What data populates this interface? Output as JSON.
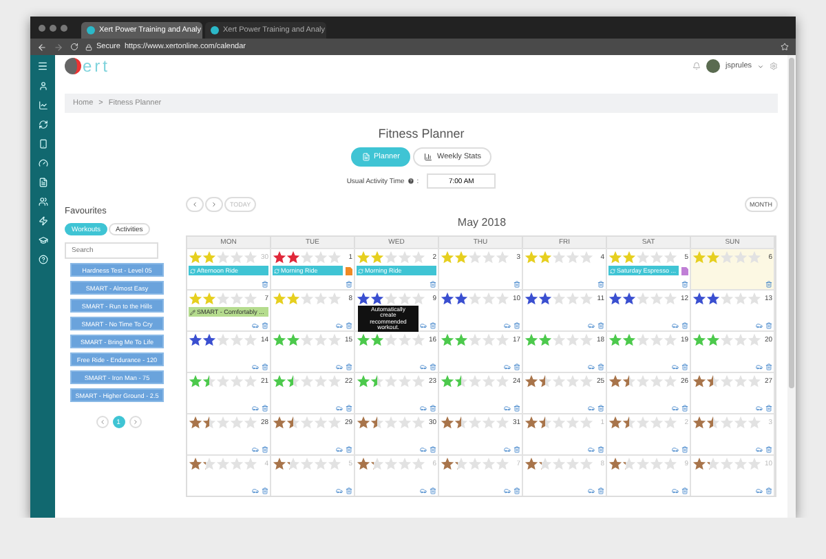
{
  "browser": {
    "tabs": [
      {
        "title": "Xert Power Training and Analy",
        "selected": true
      },
      {
        "title": "Xert Power Training and Analy",
        "selected": false
      }
    ],
    "secure_label": "Secure",
    "url": "https://www.xertonline.com/calendar"
  },
  "header": {
    "logo_text": "ert",
    "user": "jsprules"
  },
  "breadcrumb": {
    "items": [
      "Home",
      "Fitness Planner"
    ],
    "separator": ">"
  },
  "title": "Fitness Planner",
  "view_tabs": [
    {
      "label": "Planner",
      "selected": true
    },
    {
      "label": "Weekly Stats",
      "selected": false
    }
  ],
  "activity_time": {
    "label": "Usual Activity Time",
    "suffix": ":",
    "value": "7:00 AM"
  },
  "nav": {
    "today": {
      "label": "TODAY",
      "disabled": true
    },
    "view": "MONTH"
  },
  "month": "May 2018",
  "weekdays": [
    "MON",
    "TUE",
    "WED",
    "THU",
    "FRI",
    "SAT",
    "SUN"
  ],
  "weeks": [
    {
      "days": [
        {
          "number": "30",
          "muted": true,
          "today": false,
          "stars": 2,
          "color": "#e6cf1f",
          "recommend": false,
          "events": [
            {
              "kind": "activity",
              "title": "Afternoon Ride"
            }
          ]
        },
        {
          "number": "1",
          "muted": false,
          "today": false,
          "stars": 2,
          "color": "#e0283a",
          "recommend": false,
          "events": [
            {
              "kind": "activity",
              "title": "Morning Ride",
              "color": "#f08a24"
            }
          ]
        },
        {
          "number": "2",
          "muted": false,
          "today": false,
          "stars": 2,
          "color": "#e6cf1f",
          "recommend": false,
          "events": [
            {
              "kind": "activity",
              "title": "Morning Ride"
            }
          ]
        },
        {
          "number": "3",
          "muted": false,
          "today": false,
          "stars": 2,
          "color": "#e6cf1f",
          "recommend": false
        },
        {
          "number": "4",
          "muted": false,
          "today": false,
          "stars": 2,
          "color": "#e6cf1f",
          "recommend": false
        },
        {
          "number": "5",
          "muted": false,
          "today": false,
          "stars": 2,
          "color": "#e6cf1f",
          "recommend": false,
          "events": [
            {
              "kind": "activity",
              "title": "Saturday Espresso ...",
              "color": "#c07fd6"
            }
          ]
        },
        {
          "number": "6",
          "muted": false,
          "today": true,
          "stars": 2,
          "color": "#e6cf1f",
          "recommend": false
        }
      ]
    },
    {
      "days": [
        {
          "number": "7",
          "muted": false,
          "today": false,
          "stars": 2,
          "color": "#e6cf1f",
          "recommend": true,
          "events": [
            {
              "kind": "workout",
              "title": "SMART - Comfortably ..."
            }
          ]
        },
        {
          "number": "8",
          "muted": false,
          "today": false,
          "stars": 2,
          "color": "#e6cf1f",
          "recommend": true
        },
        {
          "number": "9",
          "muted": false,
          "today": false,
          "stars": 2,
          "color": "#3a4fd0",
          "recommend": true,
          "tooltip": "Automatically create recommended workout."
        },
        {
          "number": "10",
          "muted": false,
          "today": false,
          "stars": 2,
          "color": "#3a4fd0",
          "recommend": true
        },
        {
          "number": "11",
          "muted": false,
          "today": false,
          "stars": 2,
          "color": "#3a4fd0",
          "recommend": true
        },
        {
          "number": "12",
          "muted": false,
          "today": false,
          "stars": 2,
          "color": "#3a4fd0",
          "recommend": true
        },
        {
          "number": "13",
          "muted": false,
          "today": false,
          "stars": 2,
          "color": "#3a4fd0",
          "recommend": true
        }
      ]
    },
    {
      "days": [
        {
          "number": "14",
          "muted": false,
          "today": false,
          "stars": 2,
          "color": "#3a4fd0",
          "recommend": true
        },
        {
          "number": "15",
          "muted": false,
          "today": false,
          "stars": 2,
          "color": "#4cc94c",
          "recommend": true
        },
        {
          "number": "16",
          "muted": false,
          "today": false,
          "stars": 2,
          "color": "#4cc94c",
          "recommend": true
        },
        {
          "number": "17",
          "muted": false,
          "today": false,
          "stars": 2,
          "color": "#4cc94c",
          "recommend": true
        },
        {
          "number": "18",
          "muted": false,
          "today": false,
          "stars": 2,
          "color": "#4cc94c",
          "recommend": true
        },
        {
          "number": "19",
          "muted": false,
          "today": false,
          "stars": 2,
          "color": "#4cc94c",
          "recommend": true
        },
        {
          "number": "20",
          "muted": false,
          "today": false,
          "stars": 2,
          "color": "#4cc94c",
          "recommend": true
        }
      ]
    },
    {
      "days": [
        {
          "number": "21",
          "muted": false,
          "today": false,
          "stars": 1.5,
          "color": "#4cc94c",
          "recommend": true
        },
        {
          "number": "22",
          "muted": false,
          "today": false,
          "stars": 1.5,
          "color": "#4cc94c",
          "recommend": true
        },
        {
          "number": "23",
          "muted": false,
          "today": false,
          "stars": 1.5,
          "color": "#4cc94c",
          "recommend": true
        },
        {
          "number": "24",
          "muted": false,
          "today": false,
          "stars": 1.5,
          "color": "#4cc94c",
          "recommend": true
        },
        {
          "number": "25",
          "muted": false,
          "today": false,
          "stars": 1.5,
          "color": "#a8744a",
          "recommend": true
        },
        {
          "number": "26",
          "muted": false,
          "today": false,
          "stars": 1.5,
          "color": "#a8744a",
          "recommend": true
        },
        {
          "number": "27",
          "muted": false,
          "today": false,
          "stars": 1.5,
          "color": "#a8744a",
          "recommend": true
        }
      ]
    },
    {
      "days": [
        {
          "number": "28",
          "muted": false,
          "today": false,
          "stars": 1.5,
          "color": "#a8744a",
          "recommend": true
        },
        {
          "number": "29",
          "muted": false,
          "today": false,
          "stars": 1.5,
          "color": "#a8744a",
          "recommend": true
        },
        {
          "number": "30",
          "muted": false,
          "today": false,
          "stars": 1.5,
          "color": "#a8744a",
          "recommend": true
        },
        {
          "number": "31",
          "muted": false,
          "today": false,
          "stars": 1.5,
          "color": "#a8744a",
          "recommend": true
        },
        {
          "number": "1",
          "muted": true,
          "today": false,
          "stars": 1.5,
          "color": "#a8744a",
          "recommend": true
        },
        {
          "number": "2",
          "muted": true,
          "today": false,
          "stars": 1.5,
          "color": "#a8744a",
          "recommend": true
        },
        {
          "number": "3",
          "muted": true,
          "today": false,
          "stars": 1.5,
          "color": "#a8744a",
          "recommend": true
        }
      ]
    },
    {
      "days": [
        {
          "number": "4",
          "muted": true,
          "today": false,
          "stars": 1.25,
          "color": "#a8744a",
          "recommend": true
        },
        {
          "number": "5",
          "muted": true,
          "today": false,
          "stars": 1.25,
          "color": "#a8744a",
          "recommend": true
        },
        {
          "number": "6",
          "muted": true,
          "today": false,
          "stars": 1.25,
          "color": "#a8744a",
          "recommend": true
        },
        {
          "number": "7",
          "muted": true,
          "today": false,
          "stars": 1.25,
          "color": "#a8744a",
          "recommend": true
        },
        {
          "number": "8",
          "muted": true,
          "today": false,
          "stars": 1.25,
          "color": "#a8744a",
          "recommend": true
        },
        {
          "number": "9",
          "muted": true,
          "today": false,
          "stars": 1.25,
          "color": "#a8744a",
          "recommend": true
        },
        {
          "number": "10",
          "muted": true,
          "today": false,
          "stars": 1.25,
          "color": "#a8744a",
          "recommend": true
        }
      ]
    }
  ],
  "favourites": {
    "title": "Favourites",
    "tabs": [
      {
        "label": "Workouts",
        "selected": true
      },
      {
        "label": "Activities",
        "selected": false
      }
    ],
    "search_placeholder": "Search",
    "items": [
      "Hardness Test - Level 05",
      "SMART - Almost Easy",
      "SMART - Run to the Hills",
      "SMART - No Time To Cry",
      "SMART - Bring Me To Life",
      "Free Ride - Endurance - 120",
      "SMART - Iron Man - 75",
      "SMART - Higher Ground - 2.5"
    ],
    "pages": [
      {
        "label": "1",
        "selected": true
      }
    ]
  }
}
